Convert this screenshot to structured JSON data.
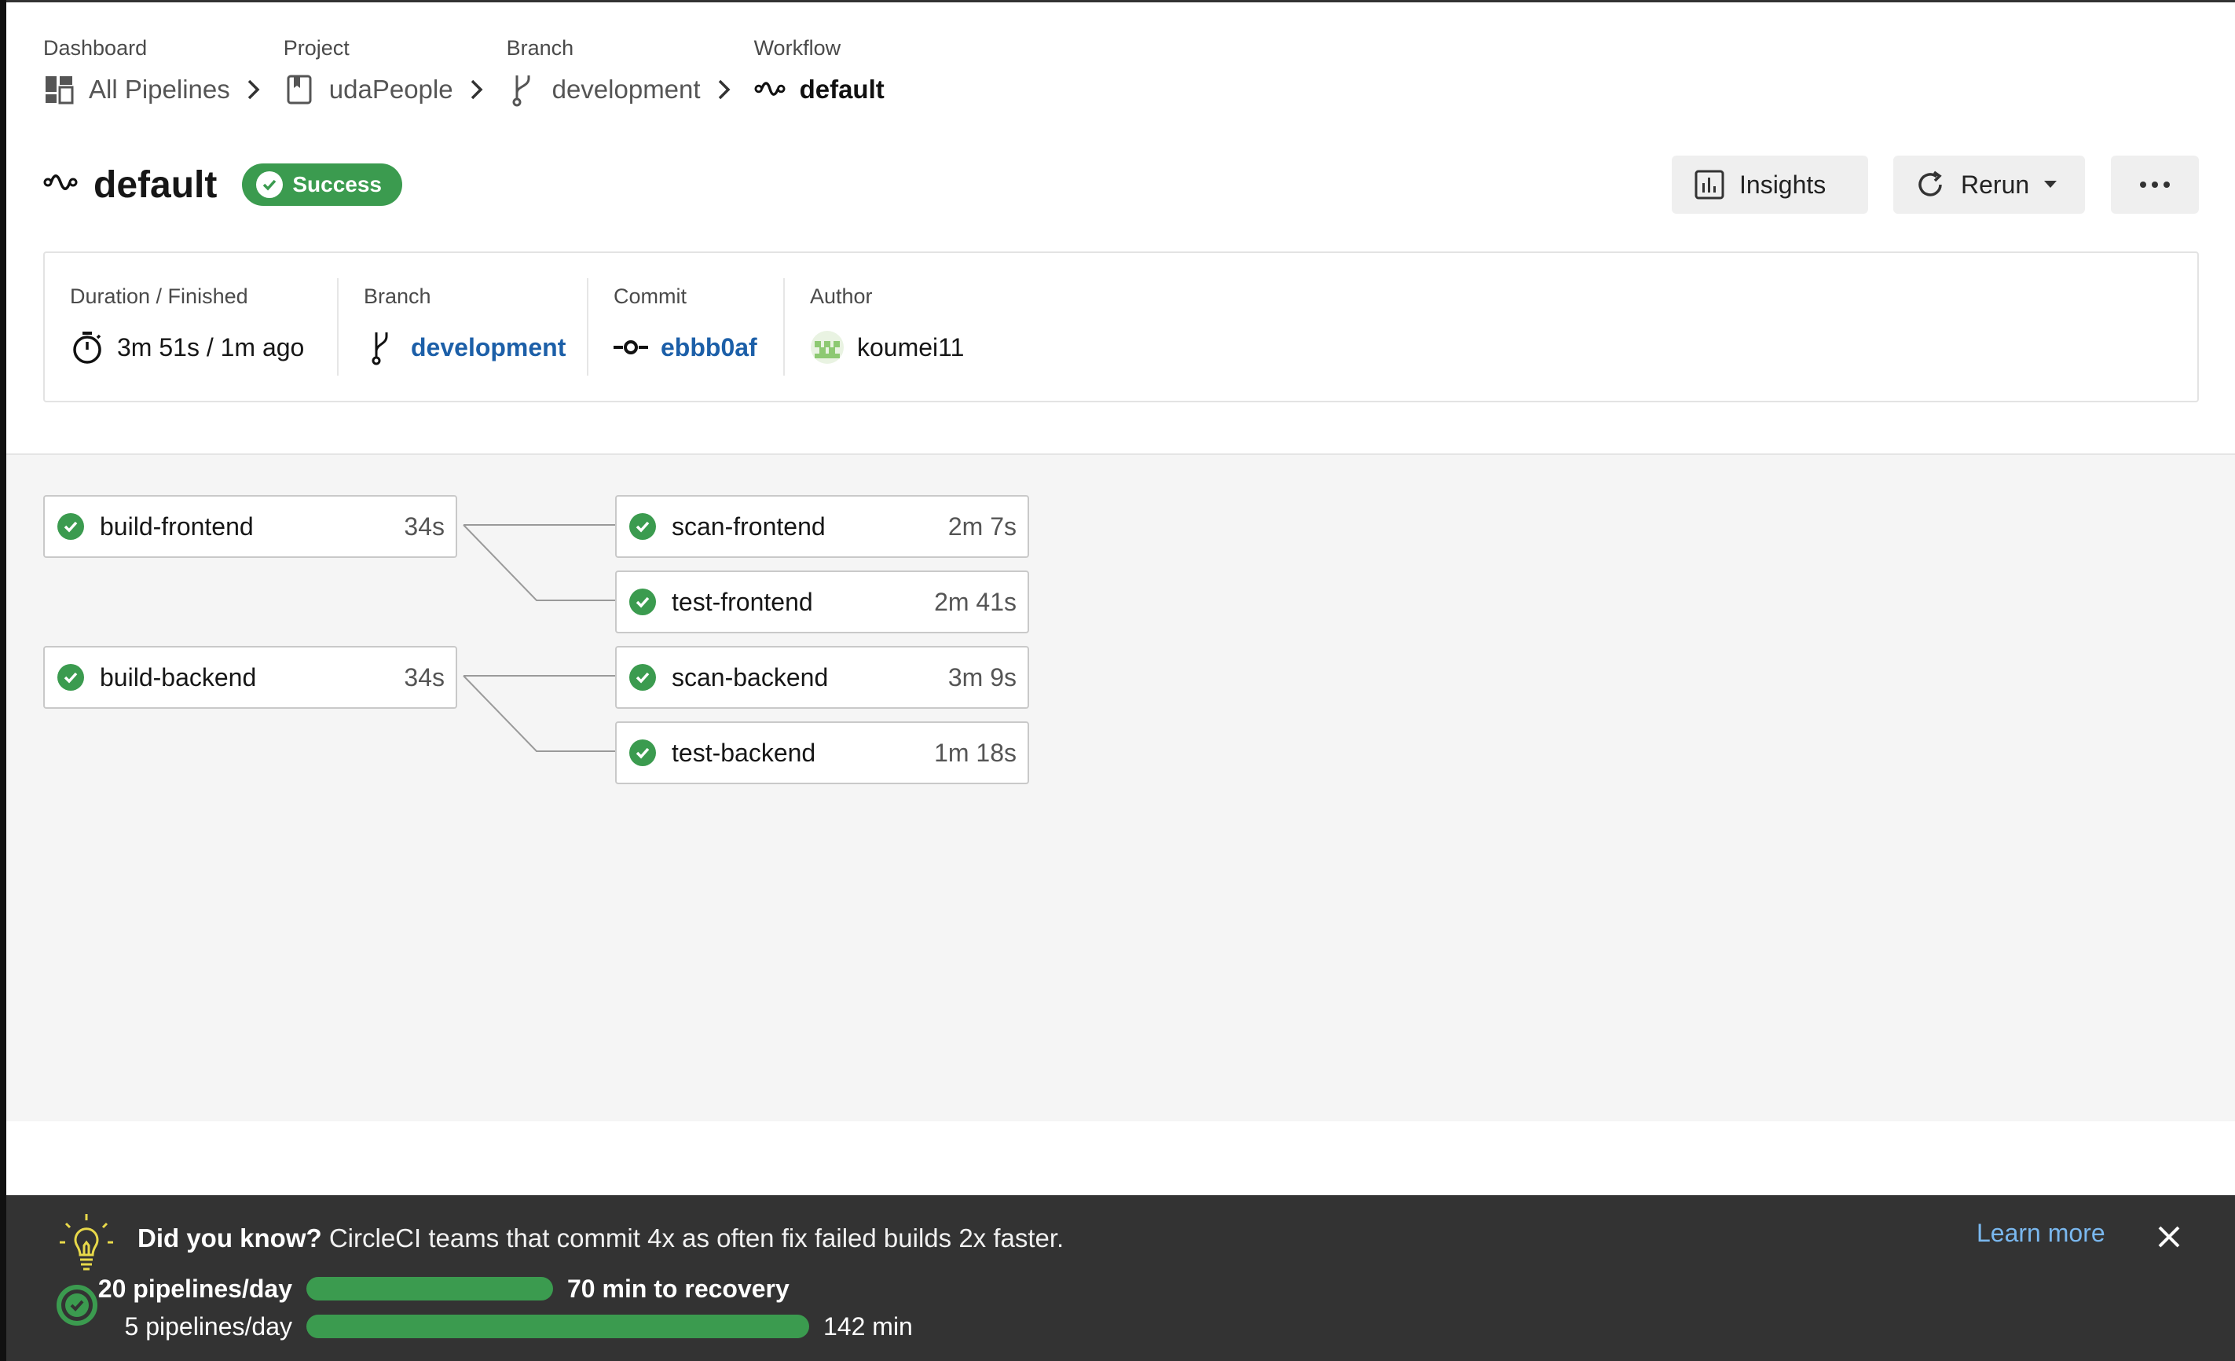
{
  "breadcrumb": [
    {
      "caption": "Dashboard",
      "label": "All Pipelines",
      "icon": "dashboard-icon"
    },
    {
      "caption": "Project",
      "label": "udaPeople",
      "icon": "project-icon"
    },
    {
      "caption": "Branch",
      "label": "development",
      "icon": "branch-icon"
    },
    {
      "caption": "Workflow",
      "label": "default",
      "icon": "workflow-icon"
    }
  ],
  "header": {
    "title": "default",
    "status": "Success",
    "status_color": "#3b9b4f",
    "insights_label": "Insights",
    "rerun_label": "Rerun"
  },
  "summary": {
    "duration": {
      "caption": "Duration / Finished",
      "value": "3m 51s / 1m ago"
    },
    "branch": {
      "caption": "Branch",
      "value": "development"
    },
    "commit": {
      "caption": "Commit",
      "value": "ebbb0af"
    },
    "author": {
      "caption": "Author",
      "value": "koumei11"
    }
  },
  "jobs": [
    {
      "name": "build-frontend",
      "duration": "34s",
      "status": "success"
    },
    {
      "name": "scan-frontend",
      "duration": "2m 7s",
      "status": "success"
    },
    {
      "name": "test-frontend",
      "duration": "2m 41s",
      "status": "success"
    },
    {
      "name": "build-backend",
      "duration": "34s",
      "status": "success"
    },
    {
      "name": "scan-backend",
      "duration": "3m 9s",
      "status": "success"
    },
    {
      "name": "test-backend",
      "duration": "1m 18s",
      "status": "success"
    }
  ],
  "banner": {
    "tip_bold": "Did you know?",
    "tip_text": " CircleCI teams that commit 4x as often fix failed builds 2x faster.",
    "learn_more": "Learn more",
    "stats": [
      {
        "label": "20 pipelines/day",
        "value": "70 min to recovery",
        "bar_fraction": 0.49
      },
      {
        "label": "5 pipelines/day",
        "value": "142 min",
        "bar_fraction": 1.0
      }
    ]
  }
}
